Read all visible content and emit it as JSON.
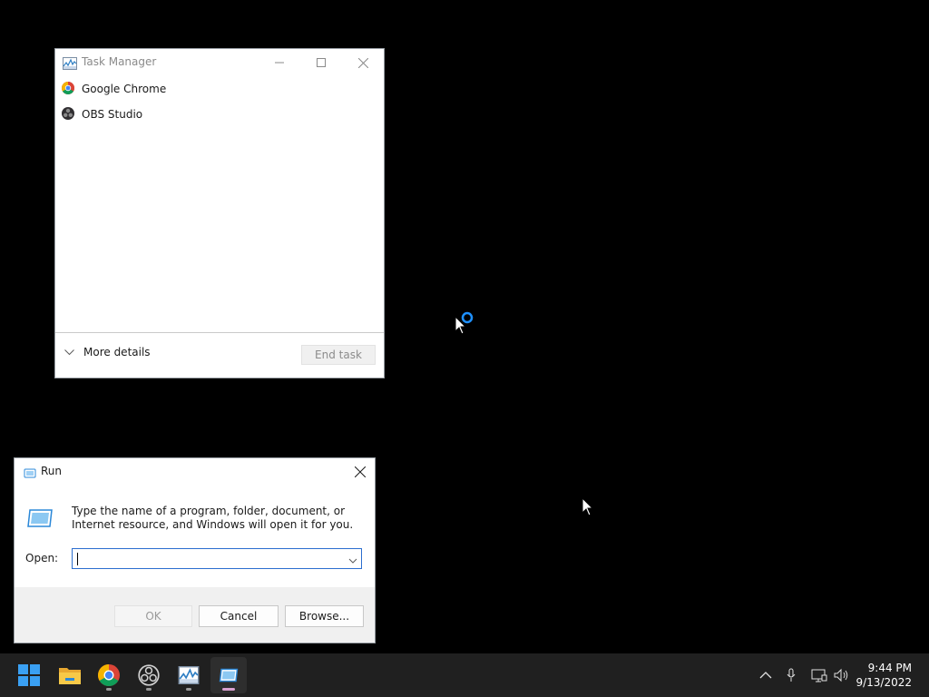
{
  "task_manager": {
    "title": "Task Manager",
    "processes": [
      {
        "name": "Google Chrome",
        "icon": "chrome-icon"
      },
      {
        "name": "OBS Studio",
        "icon": "obs-icon"
      }
    ],
    "more_details_label": "More details",
    "end_task_label": "End task"
  },
  "run_dialog": {
    "title": "Run",
    "description": "Type the name of a program, folder, document, or Internet resource, and Windows will open it for you.",
    "open_label": "Open:",
    "open_value": "",
    "ok_label": "OK",
    "cancel_label": "Cancel",
    "browse_label": "Browse..."
  },
  "taskbar": {
    "apps": [
      {
        "name": "start",
        "icon": "windows-logo-icon"
      },
      {
        "name": "file-explorer",
        "icon": "folder-icon"
      },
      {
        "name": "chrome",
        "icon": "chrome-icon"
      },
      {
        "name": "obs",
        "icon": "obs-icon"
      },
      {
        "name": "task-manager",
        "icon": "task-manager-icon"
      },
      {
        "name": "run",
        "icon": "run-icon"
      }
    ],
    "time": "9:44 PM",
    "date": "9/13/2022"
  },
  "colors": {
    "desktop": "#000000",
    "taskbar": "#202020",
    "accent": "#0078d4",
    "input_focus_border": "#2c6ecf"
  }
}
